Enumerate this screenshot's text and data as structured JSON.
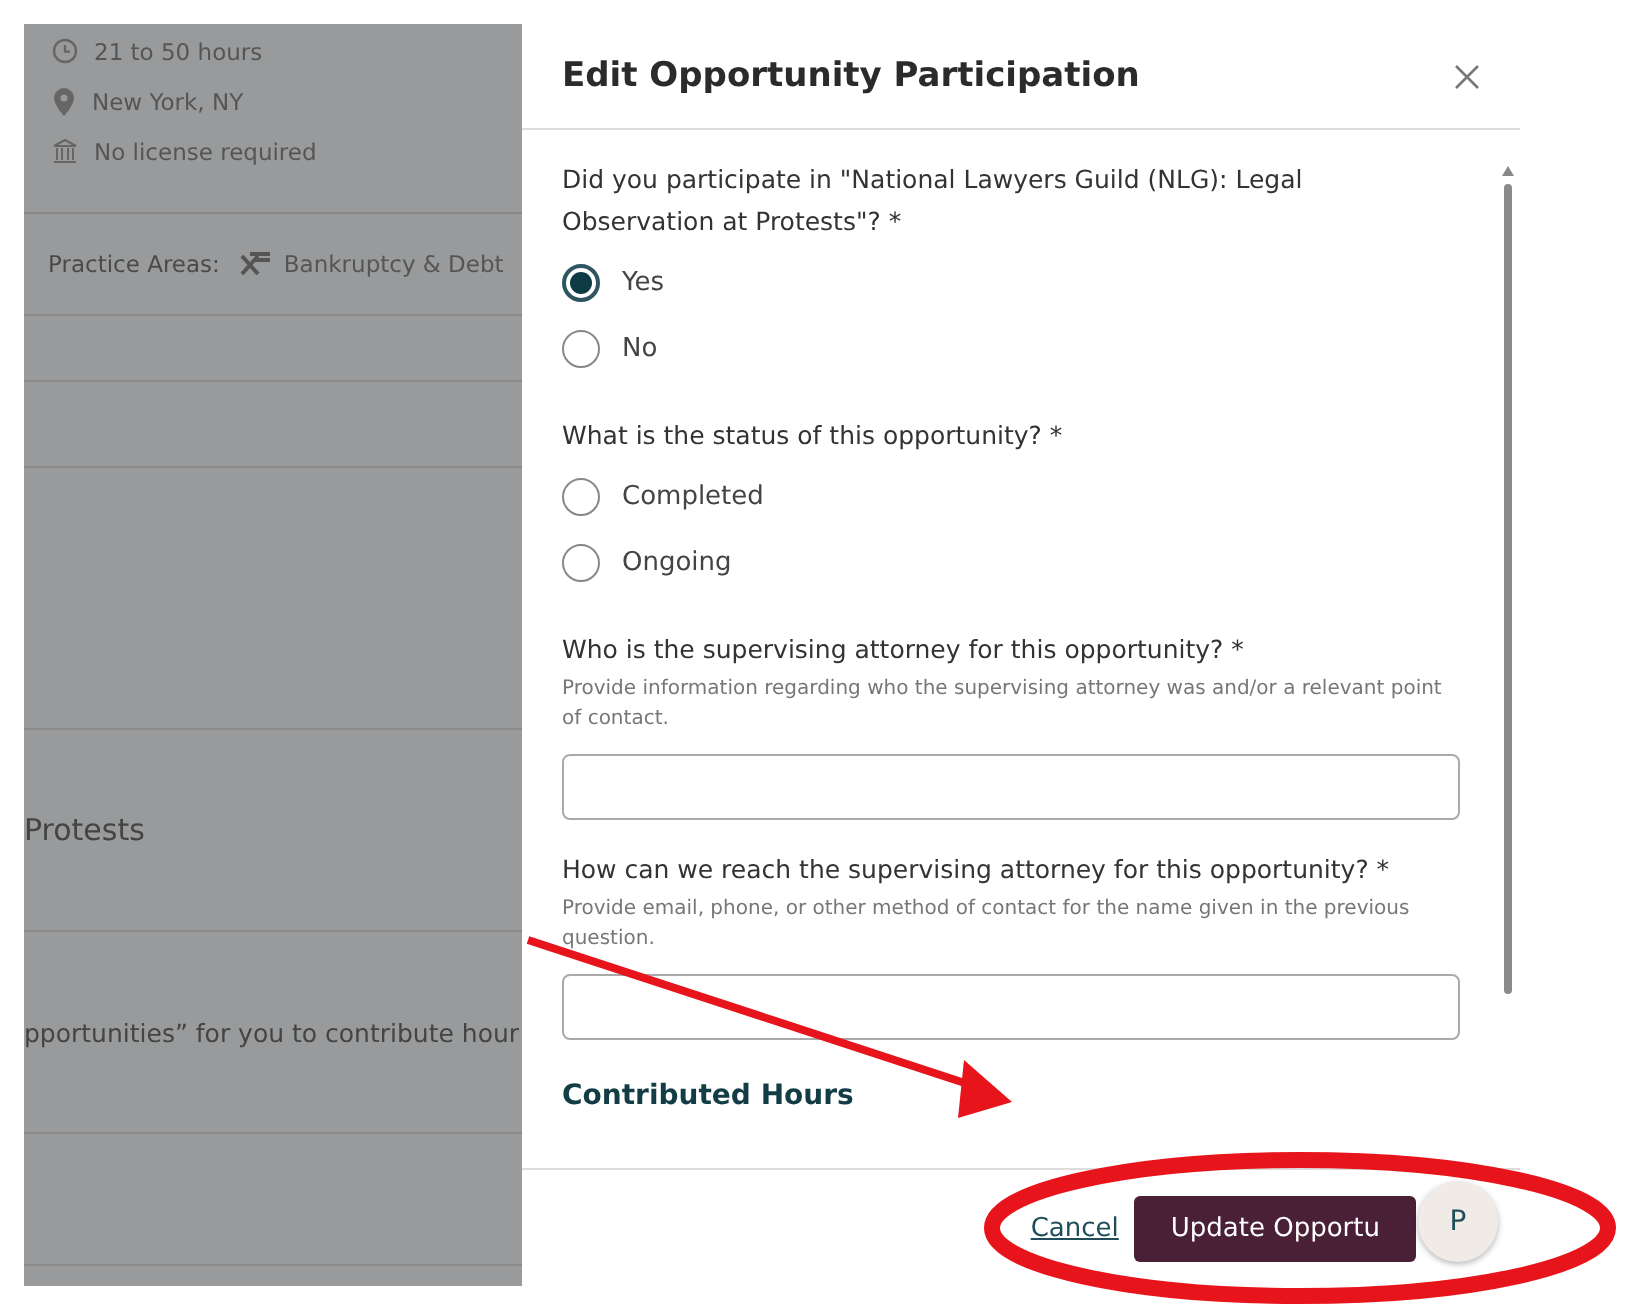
{
  "background": {
    "details": [
      {
        "kind": "clock",
        "text": "21 to 50 hours"
      },
      {
        "kind": "pin",
        "text": "New York, NY"
      },
      {
        "kind": "bank",
        "text": "No license required"
      }
    ],
    "practice_areas": {
      "label": "Practice Areas:",
      "value": "Bankruptcy & Debt"
    },
    "heading_fragment": "Protests",
    "text_fragment": "pportunities” for you to contribute hour"
  },
  "modal": {
    "title": "Edit Opportunity Participation",
    "questions": [
      {
        "kind": "radio",
        "label": "Did you participate in \"National Lawyers Guild (NLG): Legal Observation at Protests\"? *",
        "options": [
          {
            "label": "Yes",
            "selected": true
          },
          {
            "label": "No",
            "selected": false
          }
        ]
      },
      {
        "kind": "radio",
        "label": "What is the status of this opportunity? *",
        "options": [
          {
            "label": "Completed",
            "selected": false
          },
          {
            "label": "Ongoing",
            "selected": false
          }
        ]
      },
      {
        "kind": "text",
        "label": "Who is the supervising attorney for this opportunity? *",
        "help": "Provide information regarding who the supervising attorney was and/or a relevant point of contact."
      },
      {
        "kind": "text",
        "label": "How can we reach the supervising attorney for this opportunity? *",
        "help": "Provide email, phone, or other method of contact for the name given in the previous question."
      }
    ],
    "section_heading": "Contributed Hours",
    "cancel": "Cancel",
    "submit": "Update Opportu",
    "avatar": "P"
  }
}
